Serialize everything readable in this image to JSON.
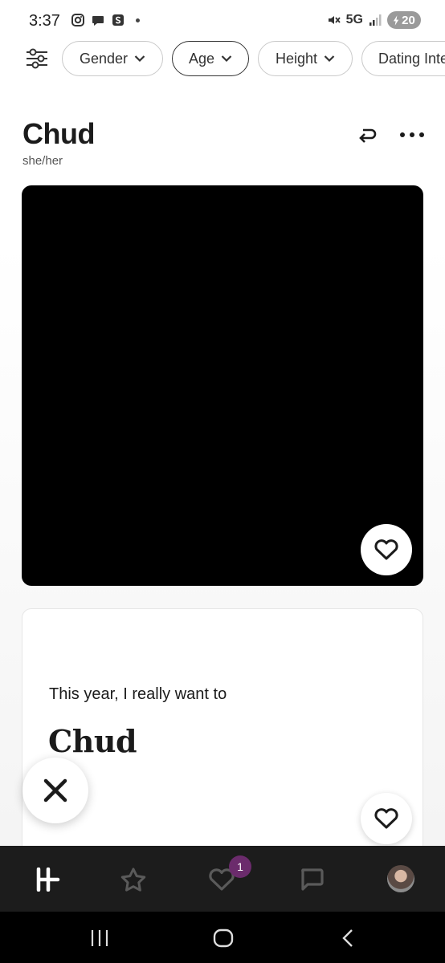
{
  "status_bar": {
    "time": "3:37",
    "network": "5G",
    "battery": "20"
  },
  "filters": {
    "chips": [
      {
        "label": "Gender"
      },
      {
        "label": "Age"
      },
      {
        "label": "Height"
      },
      {
        "label": "Dating Inte"
      }
    ]
  },
  "profile": {
    "name": "Chud",
    "pronouns": "she/her"
  },
  "prompt": {
    "question": "This year, I really want to",
    "answer": "Chud"
  },
  "nav": {
    "likes_badge": "1"
  },
  "colors": {
    "badge": "#6b2b6c",
    "nav_bg": "#1c1c1c",
    "photo_bg": "#000000"
  }
}
